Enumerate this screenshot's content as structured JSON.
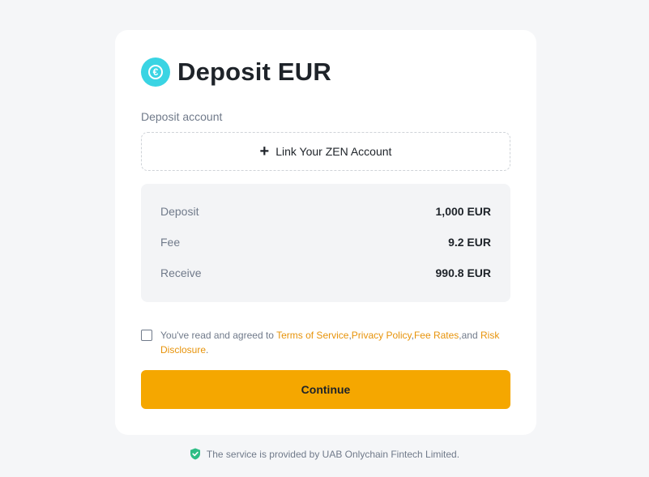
{
  "header": {
    "title": "Deposit EUR",
    "currency_icon_glyph": "€",
    "currency_icon": "euro-coin-icon",
    "icon_color": "#3ad4e3"
  },
  "deposit_account": {
    "label": "Deposit account",
    "link_button_label": "Link Your ZEN Account",
    "link_button_icon": "plus-icon"
  },
  "summary": {
    "rows": [
      {
        "key": "Deposit",
        "value": "1,000 EUR"
      },
      {
        "key": "Fee",
        "value": "9.2 EUR"
      },
      {
        "key": "Receive",
        "value": "990.8 EUR"
      }
    ]
  },
  "agreement": {
    "checked": false,
    "prefix": "You've read and agreed to ",
    "terms": "Terms of Service",
    "sep1": ",",
    "privacy": "Privacy Policy",
    "sep2": ",",
    "fees": "Fee Rates",
    "sep3": ",and ",
    "risk": "Risk Disclosure",
    "suffix": "."
  },
  "actions": {
    "continue_label": "Continue",
    "accent_color": "#f5a700"
  },
  "footer": {
    "text": "The service is provided by UAB Onlychain Fintech Limited.",
    "icon": "shield-check-icon",
    "icon_color": "#2ebd85"
  }
}
